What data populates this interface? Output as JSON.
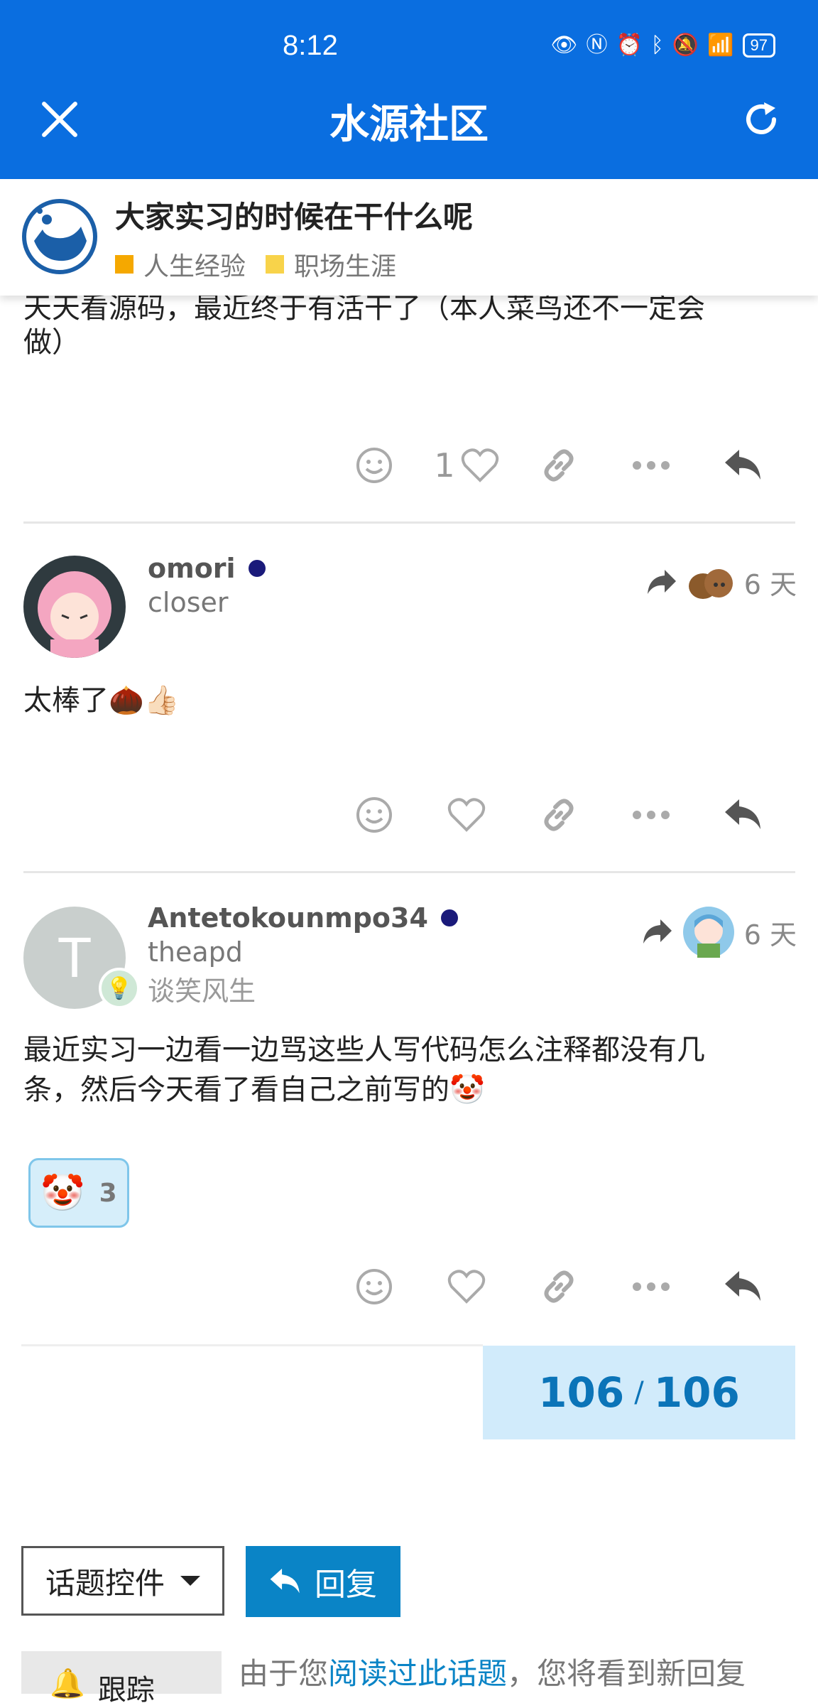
{
  "status_bar": {
    "time": "8:12",
    "battery": "97"
  },
  "app_bar": {
    "title": "水源社区"
  },
  "topic": {
    "title": "大家实习的时候在干什么呢",
    "categories": [
      {
        "name": "人生经验",
        "color": "#f5a800"
      },
      {
        "name": "职场生涯",
        "color": "#f8d34a"
      }
    ]
  },
  "posts": [
    {
      "text_line1": "天天看源码，最近终于有活干了（本人菜鸟还不一定会",
      "text_line2": "做）",
      "like_count": "1"
    },
    {
      "username": "omori",
      "user_title": "closer",
      "time": "6 天",
      "text": "太棒了🌰👍🏻"
    },
    {
      "username": "Antetokounmpo34",
      "user_title": "theapd",
      "user_badge": "谈笑风生",
      "avatar_letter": "T",
      "time": "6 天",
      "text_line1": "最近实习一边看一边骂这些人写代码怎么注释都没有几",
      "text_line2": "条，然后今天看了看自己之前写的🤡",
      "reaction": {
        "emoji": "🤡",
        "count": "3"
      }
    }
  ],
  "progress": {
    "current": "106",
    "total": "106",
    "separator": "/"
  },
  "footer": {
    "topic_controls_label": "话题控件",
    "reply_label": "回复",
    "tracking_label": "跟踪",
    "notice_prefix": "由于您",
    "notice_link": "阅读过此话题",
    "notice_suffix": "，您将看到新回复"
  },
  "colors": {
    "accent": "#0a6ee0",
    "button": "#0a84c6",
    "progress_bg": "#d1ebfb"
  }
}
